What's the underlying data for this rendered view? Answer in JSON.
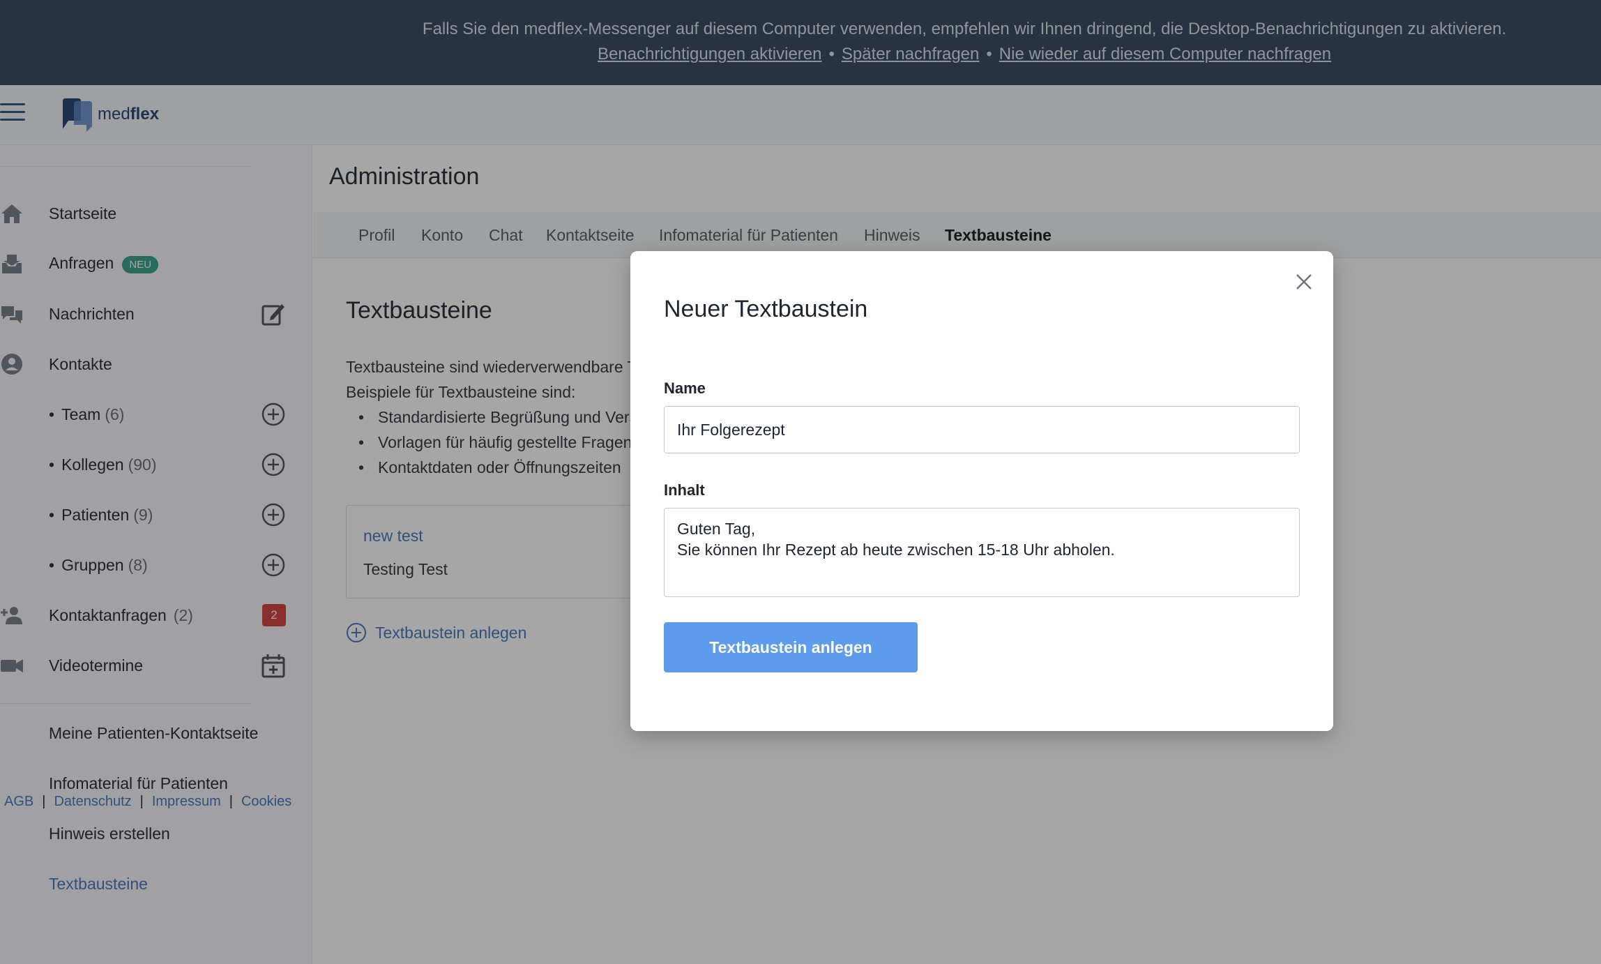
{
  "banner": {
    "message": "Falls Sie den medflex-Messenger auf diesem Computer verwenden, empfehlen wir Ihnen dringend, die Desktop-Benachrichtigungen zu aktivieren.",
    "link_activate": "Benachrichtigungen aktivieren",
    "link_later": "Später nachfragen",
    "link_never": "Nie wieder auf diesem Computer nachfragen",
    "separator": "•"
  },
  "header": {
    "logo_prefix": "med",
    "logo_suffix": "flex"
  },
  "sidebar": {
    "startseite": "Startseite",
    "anfragen": "Anfragen",
    "anfragen_badge": "NEU",
    "nachrichten": "Nachrichten",
    "kontakte": "Kontakte",
    "team": "Team",
    "team_count": "(6)",
    "kollegen": "Kollegen",
    "kollegen_count": "(90)",
    "patienten": "Patienten",
    "patienten_count": "(9)",
    "gruppen": "Gruppen",
    "gruppen_count": "(8)",
    "kontaktanfragen": "Kontaktanfragen",
    "kontaktanfragen_count": "(2)",
    "kontaktanfragen_badge": "2",
    "videotermine": "Videotermine",
    "meine_kontaktseite": "Meine Patienten-Kontaktseite",
    "infomaterial": "Infomaterial für Patienten",
    "hinweis": "Hinweis erstellen",
    "textbausteine": "Textbausteine",
    "bullet": "•"
  },
  "footer": {
    "agb": "AGB",
    "datenschutz": "Datenschutz",
    "impressum": "Impressum",
    "cookies": "Cookies",
    "sep": "|"
  },
  "main": {
    "page_title": "Administration",
    "tabs": {
      "profil": "Profil",
      "konto": "Konto",
      "chat": "Chat",
      "kontaktseite": "Kontaktseite",
      "infomaterial": "Infomaterial für Patienten",
      "hinweis": "Hinweis",
      "textbausteine": "Textbausteine"
    },
    "section_title": "Textbausteine",
    "desc_line1": "Textbausteine sind wiederverwendbare T",
    "desc_line2": "Beispiele für Textbausteine sind:",
    "bullets": [
      "Standardisierte Begrüßung und Vera",
      "Vorlagen für häufig gestellte Fragen o",
      "Kontaktdaten oder Öffnungszeiten"
    ],
    "card_title": "new test",
    "card_body": "Testing Test",
    "add_link": "Textbaustein anlegen"
  },
  "modal": {
    "title": "Neuer Textbaustein",
    "name_label": "Name",
    "name_value": "Ihr Folgerezept",
    "inhalt_label": "Inhalt",
    "inhalt_value": "Guten Tag,\nSie können Ihr Rezept ab heute zwischen 15-18 Uhr abholen.",
    "submit_label": "Textbaustein anlegen"
  },
  "colors": {
    "banner_bg": "#3e4d66",
    "accent_blue": "#4a7bc0",
    "primary_button": "#5d9bec",
    "badge_green": "#3fa58f",
    "badge_red": "#d64545"
  }
}
